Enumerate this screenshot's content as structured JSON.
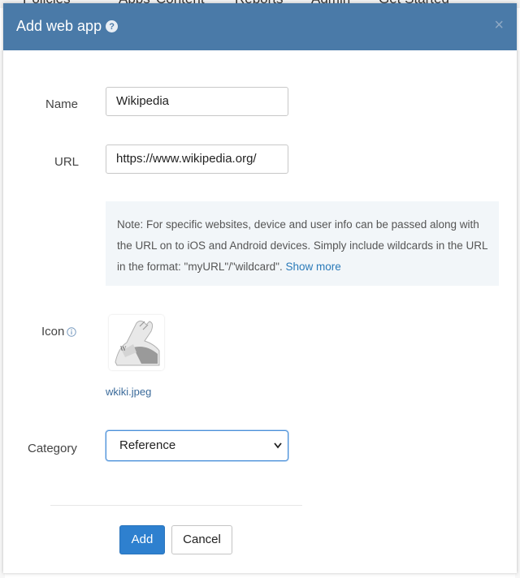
{
  "background_nav": [
    "Policies",
    "Apps",
    "Content",
    "Reports",
    "Admin",
    "Get Started"
  ],
  "modal": {
    "title": "Add web app",
    "help_icon": "question-circle-icon",
    "close_icon": "close-icon",
    "close_glyph": "×"
  },
  "form": {
    "name_label": "Name",
    "name_value": "Wikipedia",
    "url_label": "URL",
    "url_value": "https://www.wikipedia.org/",
    "note_text": "Note: For specific websites, device and user info can be passed along with the URL on to iOS and Android devices. Simply include wildcards in the URL in the format: \"myURL\"/\"wildcard\".",
    "show_more": "Show more",
    "icon_label": "Icon",
    "icon_info": "info-icon",
    "icon_filename": "wkiki.jpeg",
    "category_label": "Category",
    "category_value": "Reference"
  },
  "buttons": {
    "add": "Add",
    "cancel": "Cancel"
  },
  "colors": {
    "header": "#4a7aa8",
    "primary": "#2e80cf",
    "link": "#2a7ab9",
    "note_bg": "#f2f6f9"
  }
}
